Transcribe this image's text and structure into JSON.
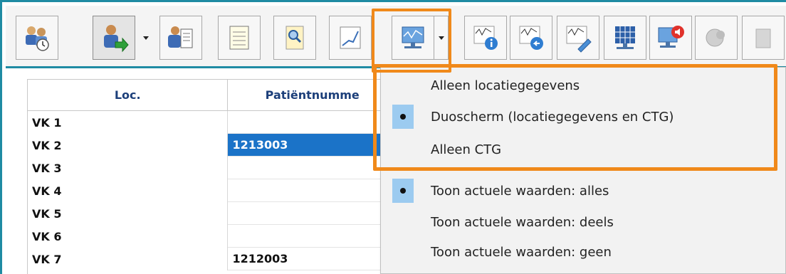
{
  "toolbar": {
    "buttons": [
      {
        "icon": "patients-icon"
      },
      {
        "icon": "patient-admit-icon",
        "has_dropdown": true
      },
      {
        "icon": "patient-card-icon"
      },
      {
        "icon": "notes-icon"
      },
      {
        "icon": "search-document-icon"
      },
      {
        "icon": "chart-icon"
      },
      {
        "icon": "monitor-view-icon",
        "has_dropdown": true,
        "highlighted": true
      },
      {
        "icon": "ctg-info-icon"
      },
      {
        "icon": "ctg-back-icon"
      },
      {
        "icon": "ctg-edit-icon"
      },
      {
        "icon": "grid-view-icon"
      },
      {
        "icon": "alarm-monitor-icon"
      },
      {
        "icon": "disabled-tool-icon"
      },
      {
        "icon": "disabled-tool-2-icon"
      }
    ]
  },
  "grid": {
    "headers": {
      "loc": "Loc.",
      "patient": "Patiëntnumme"
    },
    "rows": [
      {
        "loc": "VK 1",
        "patient": ""
      },
      {
        "loc": "VK 2",
        "patient": "1213003",
        "selected": true
      },
      {
        "loc": "VK 3",
        "patient": ""
      },
      {
        "loc": "VK 4",
        "patient": ""
      },
      {
        "loc": "VK 5",
        "patient": ""
      },
      {
        "loc": "VK 6",
        "patient": ""
      },
      {
        "loc": "VK 7",
        "patient": "1212003"
      }
    ]
  },
  "menu": {
    "items": [
      {
        "label": "Alleen locatiegegevens",
        "checked": false
      },
      {
        "label": "Duoscherm (locatiegegevens en CTG)",
        "checked": true
      },
      {
        "label": "Alleen CTG",
        "checked": false
      },
      {
        "label": "Toon actuele waarden: alles",
        "checked": true
      },
      {
        "label": "Toon actuele waarden: deels",
        "checked": false
      },
      {
        "label": "Toon actuele waarden: geen",
        "checked": false
      }
    ]
  },
  "colors": {
    "frame": "#1f8ba3",
    "highlight": "#f0891a",
    "selection": "#1b73c8",
    "check_bg": "#9ccbf0",
    "header_text": "#1c3f7a"
  }
}
